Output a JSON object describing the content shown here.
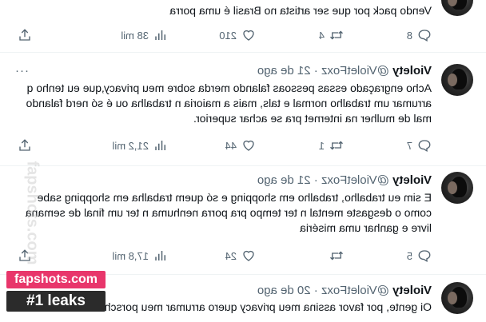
{
  "posts": [
    {
      "name": "",
      "handle": "",
      "text": "Vendo pack por que ser artista no Brasil é uma porra",
      "replies": "8",
      "reposts": "4",
      "likes": "210",
      "views": "38 mil"
    },
    {
      "name": "Violety",
      "handle": "@VioletFoxz · 21 de ago",
      "more": "···",
      "text": "Acho engraçado essas  pessoas falando merda sobre meu privacy,que eu tenho q arrumar um trabalho  normal e tals, mais a maioria n trabalha ou é só nerd falando mal de mulher na internet pra se achar superior.",
      "replies": "7",
      "reposts": "1",
      "likes": "44",
      "views": "21,2 mil"
    },
    {
      "name": "Violety",
      "handle": "@VioletFoxz · 21 de ago",
      "text": "E sim eu trabalho, trabalho em shopping e só quem trabalha em shopping sabe como o desgaste mental n ter tempo pra porra nenhuma n ter um final de semana livre e ganhar uma miséria",
      "replies": "5",
      "reposts": "",
      "likes": "24",
      "views": "17,8 mil"
    },
    {
      "name": "Violety",
      "handle": "@VioletFoxz · 20 de ago",
      "text": "Oi gente, por favor assina meu privacy quero arrumar meu porsche"
    }
  ],
  "watermark": {
    "site": "fapshots.com",
    "tag": "#1 leaks",
    "side": "fapshots.com"
  },
  "icons": {
    "reply": "reply-icon",
    "repost": "repost-icon",
    "like": "heart-icon",
    "views": "views-icon",
    "share": "share-icon"
  },
  "colors": {
    "badge_pink": "#e8366b",
    "badge_dark": "#2b2b2b",
    "secondary_text": "#536471"
  }
}
